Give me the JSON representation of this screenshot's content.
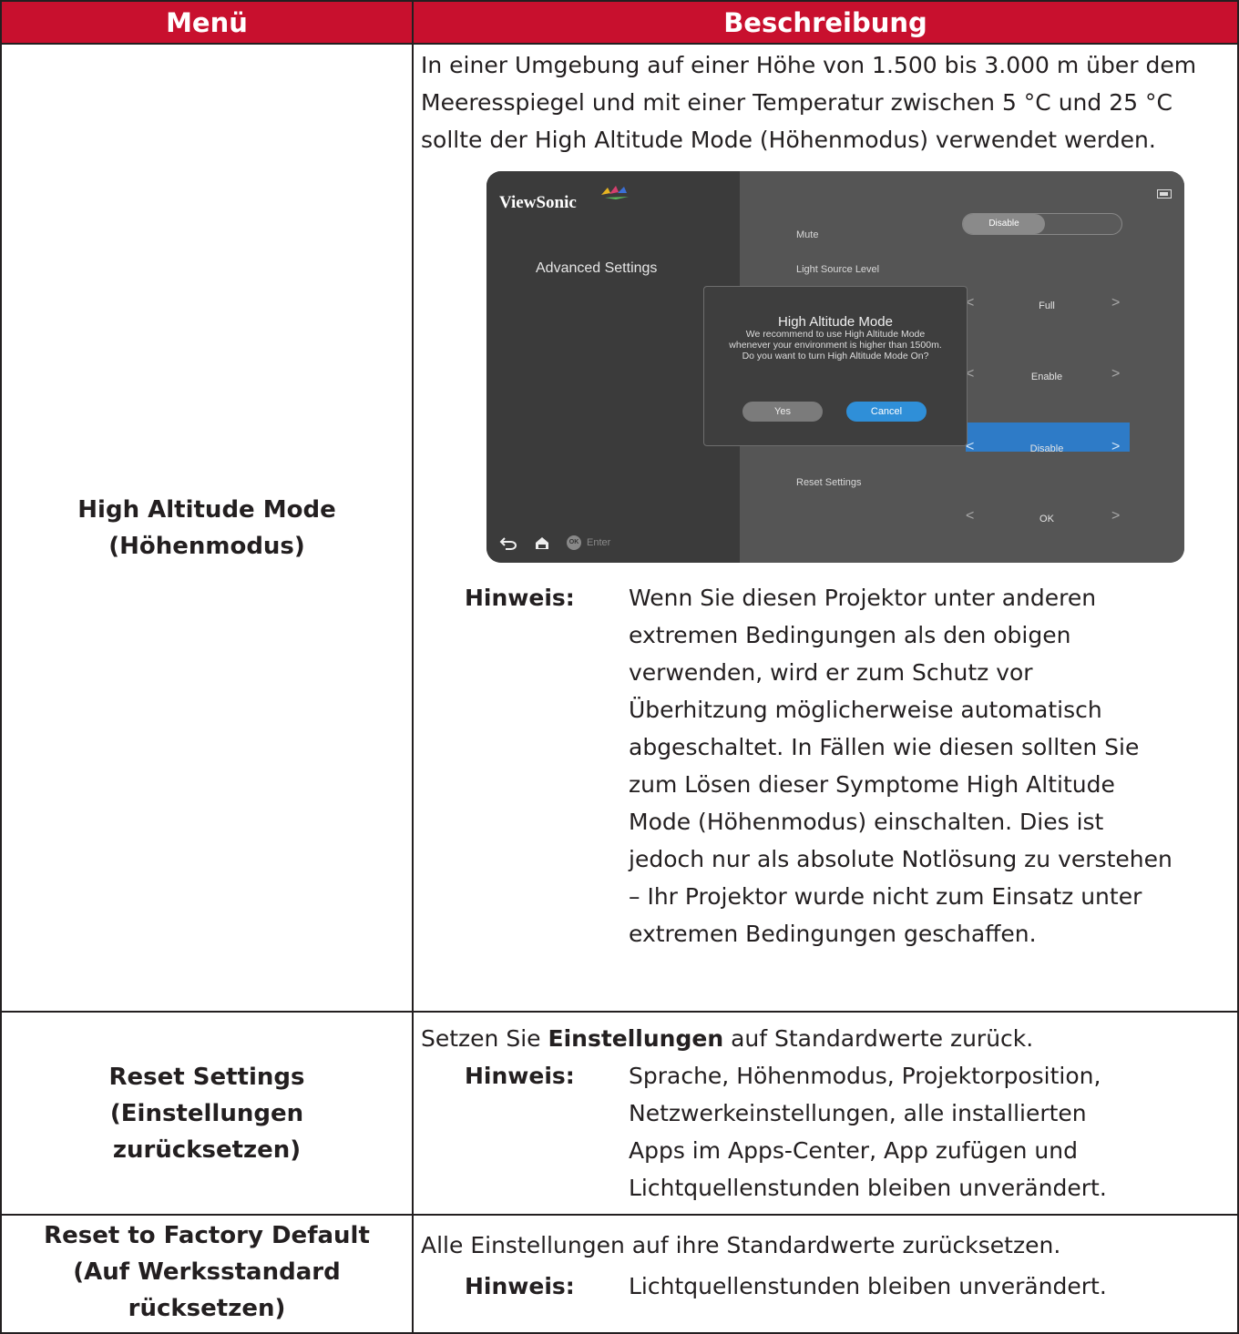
{
  "header": {
    "menu": "Menü",
    "description": "Beschreibung"
  },
  "rows": [
    {
      "menu": [
        "High Altitude Mode",
        "(Höhenmodus)"
      ],
      "intro": "In einer Umgebung auf einer Höhe von 1.500 bis 3.000 m über dem Meeresspiegel und mit einer Temperatur zwischen 5 °C und 25 °C sollte der High Altitude Mode (Höhenmodus) verwendet werden.",
      "note_label": "Hinweis:",
      "note_lines": [
        "Wenn Sie diesen Projektor unter anderen",
        "extremen Bedingungen als den obigen",
        "verwenden, wird er zum Schutz vor",
        "Überhitzung möglicherweise automatisch",
        "abgeschaltet. In Fällen wie diesen sollten Sie",
        "zum Lösen dieser Symptome High Altitude",
        "Mode (Höhenmodus) einschalten. Dies ist",
        "jedoch nur als absolute Notlösung zu verstehen",
        "– Ihr Projektor wurde nicht zum Einsatz unter",
        "extremen Bedingungen geschaffen."
      ]
    },
    {
      "menu": [
        "Reset Settings",
        "(Einstellungen",
        "zurücksetzen)"
      ],
      "intro_pre": "Setzen Sie ",
      "intro_bold": "Einstellungen",
      "intro_post": " auf Standardwerte zurück.",
      "note_label": "Hinweis:",
      "note_lines": [
        "Sprache, Höhenmodus, Projektorposition,",
        "Netzwerkeinstellungen, alle installierten",
        "Apps im Apps-Center, App zufügen und",
        "Lichtquellenstunden bleiben unverändert."
      ]
    },
    {
      "menu": [
        "Reset to Factory Default",
        "(Auf Werksstandard",
        "rücksetzen)"
      ],
      "intro": "Alle Einstellungen auf ihre Standardwerte zurücksetzen.",
      "note_label": "Hinweis:",
      "note_lines": [
        "Lichtquellenstunden bleiben unverändert."
      ]
    }
  ],
  "screenshot": {
    "brand": "ViewSonic",
    "panel_title": "Advanced Settings",
    "settings": {
      "mute_label": "Mute",
      "mute_value": "Disable",
      "light_label": "Light Source Level",
      "light_value": "Full",
      "row2_value": "Enable",
      "altitude_value": "Disable",
      "reset_label": "Reset Settings",
      "reset_value": "OK"
    },
    "dialog": {
      "title": "High Altitude Mode",
      "message": "We recommend to use High Altitude Mode whenever your environment is higher than 1500m. Do you want to turn High Altitude Mode On?",
      "yes": "Yes",
      "cancel": "Cancel"
    },
    "footer": {
      "ok_badge": "OK",
      "enter": "Enter"
    },
    "icons": [
      "back-icon",
      "home-icon",
      "battery-icon",
      "chevron-left-icon",
      "chevron-right-icon"
    ],
    "accent_color": "#2e7bc7"
  },
  "colors": {
    "header_bg": "#c8102e",
    "text": "#231f20"
  }
}
